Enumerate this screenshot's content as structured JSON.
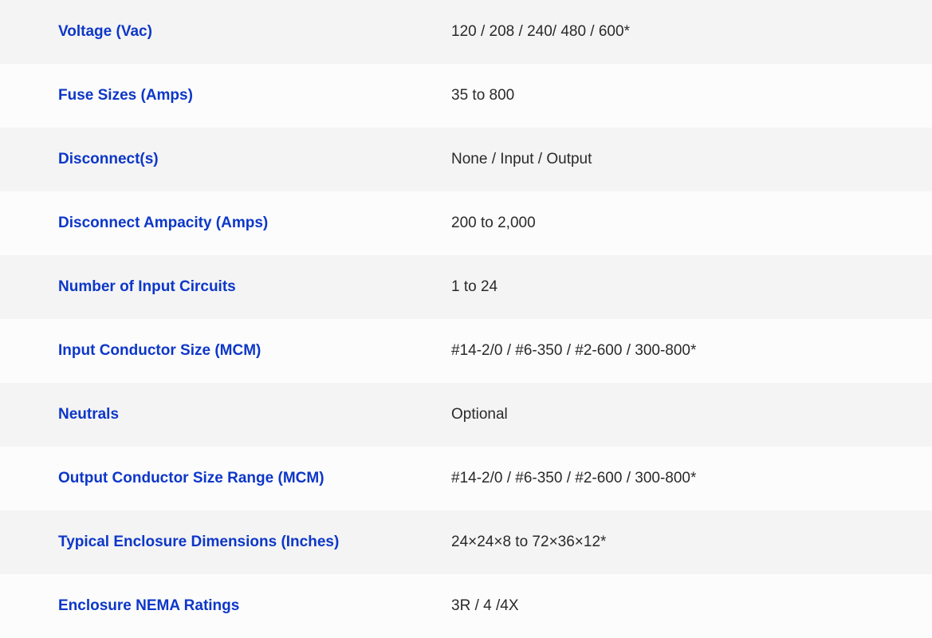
{
  "colors": {
    "label": "#0d37c8",
    "value": "#2a2a2a",
    "row_odd": "#f4f4f4",
    "row_even": "#fcfcfc"
  },
  "specs": [
    {
      "label": "Voltage (Vac)",
      "value": "120 / 208 / 240/ 480 / 600*"
    },
    {
      "label": "Fuse Sizes (Amps)",
      "value": "35 to 800"
    },
    {
      "label": "Disconnect(s)",
      "value": "None / Input / Output"
    },
    {
      "label": "Disconnect Ampacity (Amps)",
      "value": "200 to 2,000"
    },
    {
      "label": "Number of Input Circuits",
      "value": "1 to 24"
    },
    {
      "label": "Input Conductor Size (MCM)",
      "value": "#14-2/0 / #6-350 / #2-600 / 300-800*"
    },
    {
      "label": "Neutrals",
      "value": "Optional"
    },
    {
      "label": "Output Conductor Size Range (MCM)",
      "value": "#14-2/0 / #6-350 / #2-600 / 300-800*"
    },
    {
      "label": "Typical Enclosure Dimensions (Inches)",
      "value": "24×24×8 to 72×36×12*"
    },
    {
      "label": "Enclosure NEMA Ratings",
      "value": "3R / 4 /4X"
    }
  ]
}
